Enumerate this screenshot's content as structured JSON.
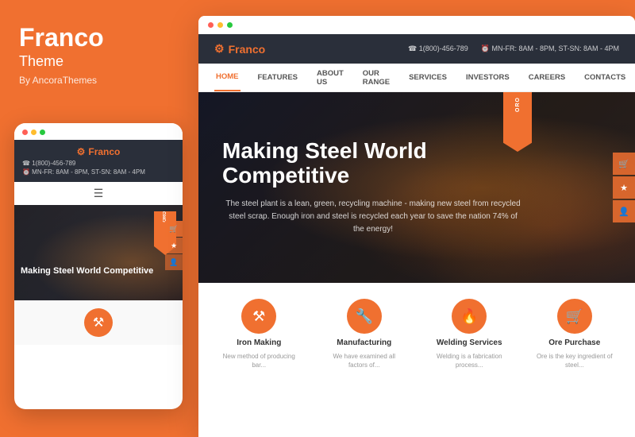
{
  "left": {
    "title": "Franco",
    "subtitle": "Theme",
    "by": "By AncoraThemes"
  },
  "dots": [
    "#ff5f56",
    "#ffbd2e",
    "#27c93f"
  ],
  "mobile": {
    "logo": "Franco",
    "phone": "☎ 1(800)-456-789",
    "hours": "⏰ MN-FR: 8AM - 8PM, ST-SN: 8AM - 4PM",
    "hero_text": "Making Steel World Competitive",
    "feature_icon": "⚒"
  },
  "desktop": {
    "logo": "Franco",
    "header": {
      "phone": "☎ 1(800)-456-789",
      "hours": "⏰ MN-FR: 8AM - 8PM, ST-SN: 8AM - 4PM"
    },
    "nav": [
      {
        "label": "HOME",
        "active": true
      },
      {
        "label": "FEATURES",
        "active": false
      },
      {
        "label": "ABOUT US",
        "active": false
      },
      {
        "label": "OUR RANGE",
        "active": false
      },
      {
        "label": "SERVICES",
        "active": false
      },
      {
        "label": "INVESTORS",
        "active": false
      },
      {
        "label": "CAREERS",
        "active": false
      },
      {
        "label": "CONTACTS",
        "active": false
      }
    ],
    "hero": {
      "title": "Making Steel World Competitive",
      "description": "The steel plant is a lean, green, recycling machine - making new steel from recycled steel scrap.\nEnough iron and steel is recycled each year to save the nation 74% of the energy!"
    },
    "bookmark_text": "ORO",
    "features": [
      {
        "icon": "⚒",
        "label": "Iron Making",
        "desc": "New method of producing bar..."
      },
      {
        "icon": "🔧",
        "label": "Manufacturing",
        "desc": "We have examined all factors of..."
      },
      {
        "icon": "🔥",
        "label": "Welding Services",
        "desc": "Welding is a fabrication process..."
      },
      {
        "icon": "🛒",
        "label": "Ore Purchase",
        "desc": "Ore is the key ingredient of steel..."
      }
    ]
  },
  "colors": {
    "accent": "#f07030",
    "dark": "#2a2f3a",
    "white": "#ffffff",
    "light_gray": "#f9f9f9"
  }
}
